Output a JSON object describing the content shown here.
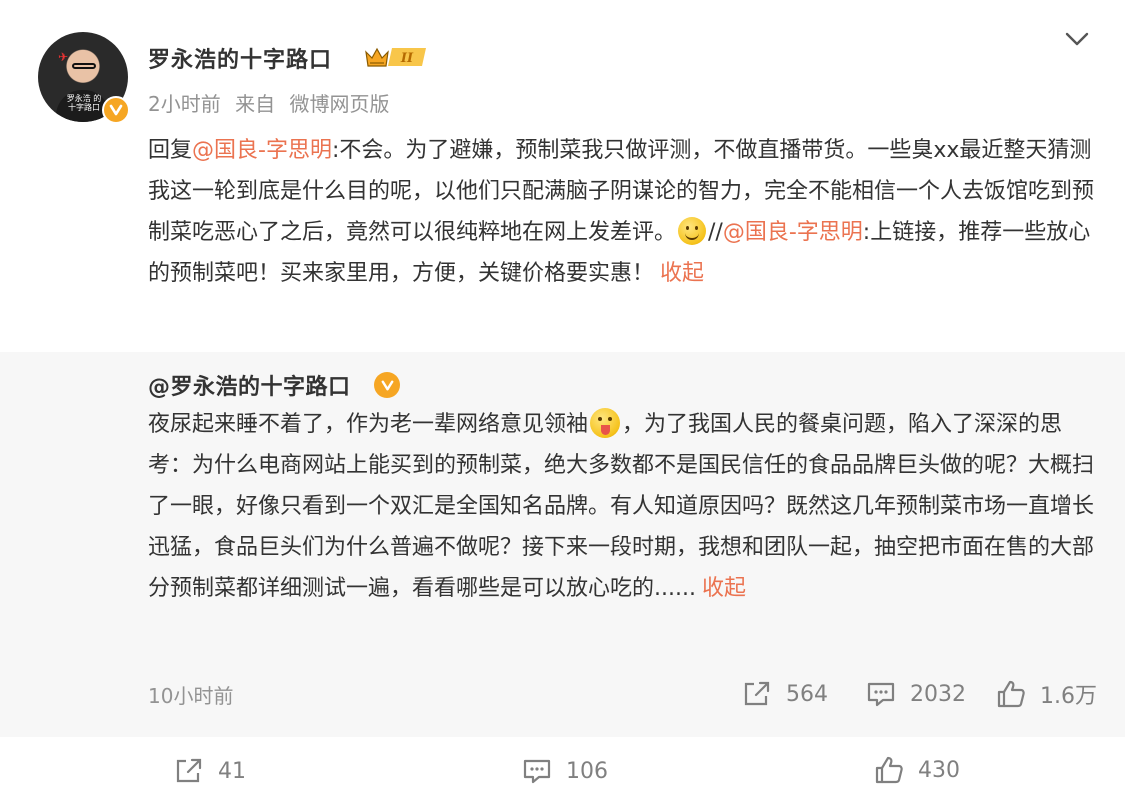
{
  "post": {
    "author": "罗永浩的十字路口",
    "avatar_caption": "罗永浩 的十字路口",
    "member_level": "II",
    "time": "2小时前",
    "source_prefix": "来自",
    "source": "微博网页版",
    "reply_prefix": "回复",
    "mention_1": "@国良-字思明",
    "text_1": ":不会。为了避嫌，预制菜我只做评测，不做直播带货。一些臭xx最近整天猜测我这一轮到底是什么目的呢，以他们只配满脑子阴谋论的智力，完全不能相信一个人去饭馆吃到预制菜吃恶心了之后，竟然可以很纯粹地在网上发差评。",
    "separator": "//",
    "mention_2": "@国良-字思明",
    "text_2": ":上链接，推荐一些放心的预制菜吧！买来家里用，方便，关键价格要实惠！",
    "collapse_label": "收起",
    "emoji_name": "smile-emoji"
  },
  "repost": {
    "author": "@罗永浩的十字路口",
    "text_1": "夜尿起来睡不着了，作为老一辈网络意见领袖",
    "emoji_name": "tongue-emoji",
    "text_2": "，为了我国人民的餐桌问题，陷入了深深的思考：为什么电商网站上能买到的预制菜，绝大多数都不是国民信任的食品品牌巨头做的呢？大概扫了一眼，好像只看到一个双汇是全国知名品牌。有人知道原因吗？既然这几年预制菜市场一直增长迅猛，食品巨头们为什么普遍不做呢？接下来一段时期，我想和团队一起，抽空把市面在售的大部分预制菜都详细测试一遍，看看哪些是可以放心吃的......",
    "collapse_label": "收起",
    "time": "10小时前",
    "reposts": "564",
    "comments": "2032",
    "likes": "1.6万"
  },
  "footer": {
    "reposts": "41",
    "comments": "106",
    "likes": "430"
  },
  "colors": {
    "mention": "#eb7350",
    "meta_gray": "#939393",
    "repost_bg": "#f7f7f7",
    "verified": "#f6a623"
  }
}
